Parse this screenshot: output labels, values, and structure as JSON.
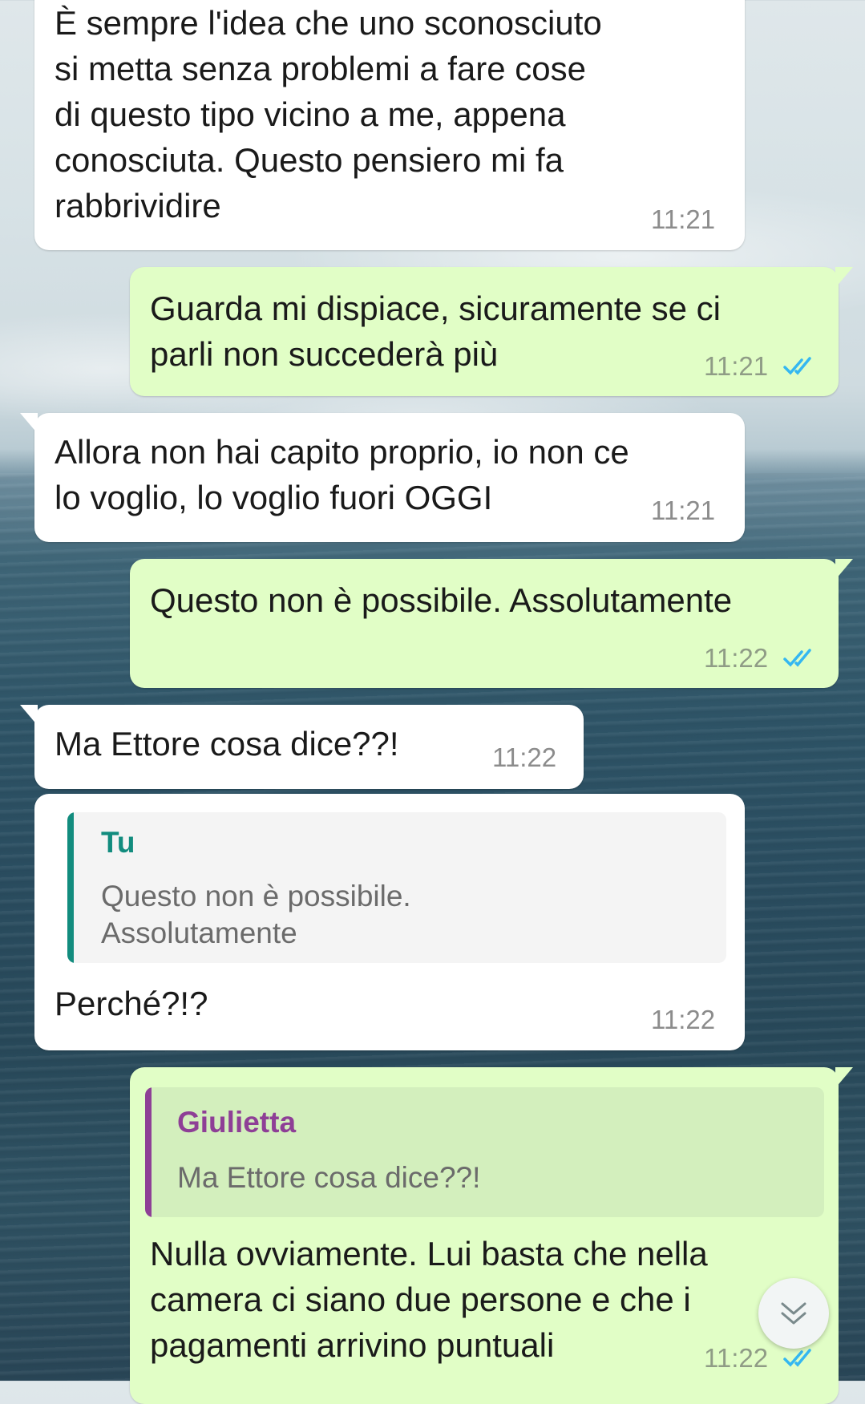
{
  "messages": [
    {
      "direction": "in",
      "text": "È sempre l'idea che uno sconosciuto\nsi metta senza problemi a fare cose\ndi questo tipo vicino a me, appena\nconosciuta. Questo pensiero mi fa\nrabbrividire",
      "time": "11:21"
    },
    {
      "direction": "out",
      "text": "Guarda mi dispiace, sicuramente se ci\nparli non succederà più",
      "time": "11:21",
      "status": "read"
    },
    {
      "direction": "in",
      "text": "Allora non hai capito proprio, io non ce\nlo voglio, lo voglio fuori OGGI",
      "time": "11:21"
    },
    {
      "direction": "out",
      "text": "Questo non è possibile. Assolutamente",
      "time": "11:22",
      "status": "read"
    },
    {
      "direction": "in",
      "text": "Ma Ettore cosa dice??!",
      "time": "11:22"
    },
    {
      "direction": "in",
      "text": "Perché?!?",
      "time": "11:22",
      "quote": {
        "author": "Tu",
        "text": "Questo non è possibile.\nAssolutamente"
      }
    },
    {
      "direction": "out",
      "text": "Nulla ovviamente. Lui basta che nella\ncamera ci siano due persone e che i\npagamenti arrivino puntuali",
      "time": "11:22",
      "status": "read",
      "quote": {
        "author": "Giulietta",
        "text": "Ma Ettore cosa dice??!"
      }
    }
  ],
  "colors": {
    "incoming_bubble": "#ffffff",
    "outgoing_bubble": "#e1fec6",
    "read_ticks": "#34b7f1",
    "quote_you": "#128c7e",
    "quote_giulietta": "#8e3f96"
  },
  "icons": {
    "read_status": "double-check-icon",
    "scroll_down": "chevron-down-icon"
  }
}
